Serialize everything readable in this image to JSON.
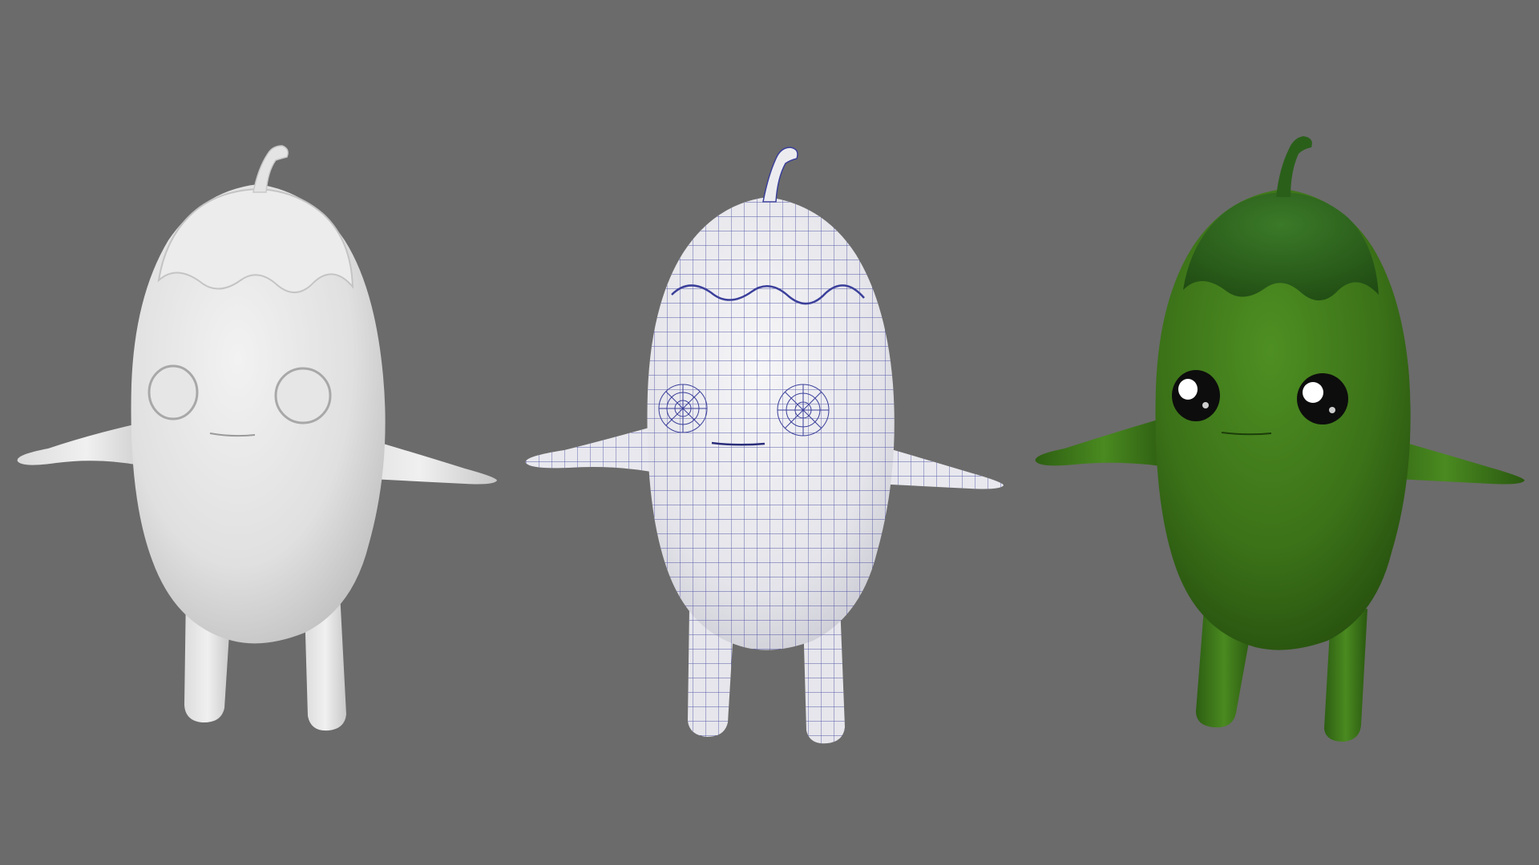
{
  "scene": {
    "background_color": "#6b6b6b",
    "subject": "pepper-character",
    "views": [
      {
        "id": "clay",
        "render_style": "clay-shaded",
        "body_color": "#e8e8e8",
        "shade_color": "#bdbdbd",
        "eye_style": "carved-sockets"
      },
      {
        "id": "wireframe",
        "render_style": "wireframe-over-shaded",
        "body_color": "#ececf0",
        "shade_color": "#c4c4cc",
        "wire_color": "#3b3f9a",
        "eye_style": "radial-mesh-sockets"
      },
      {
        "id": "textured",
        "render_style": "textured-render",
        "body_color": "#3f7a1c",
        "shade_color": "#24500d",
        "leaf_color": "#2f5f1c",
        "eye_style": "glossy-black-eyes"
      }
    ]
  }
}
